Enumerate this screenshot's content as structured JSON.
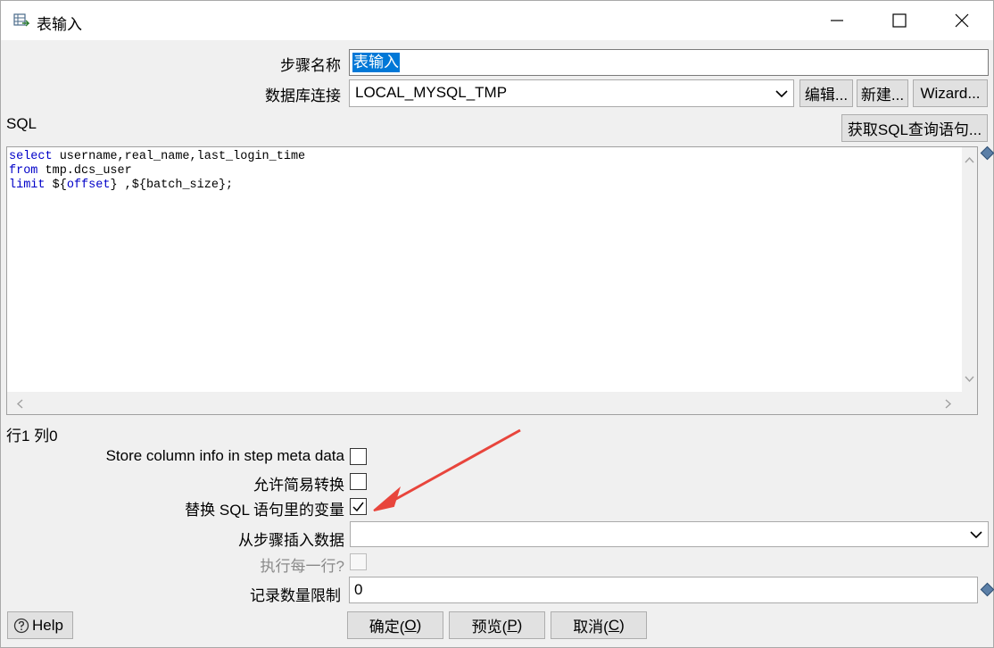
{
  "window": {
    "title": "表输入",
    "minimize_icon": "minimize-icon",
    "maximize_icon": "maximize-icon",
    "close_icon": "close-icon"
  },
  "form": {
    "step_name_label": "步骤名称",
    "step_name_value": "表输入",
    "connection_label": "数据库连接",
    "connection_value": "LOCAL_MYSQL_TMP",
    "edit_button": "编辑...",
    "new_button": "新建...",
    "wizard_button": "Wizard...",
    "sql_label": "SQL",
    "get_sql_button": "获取SQL查询语句...",
    "sql_line1_kw": "select",
    "sql_line1_rest": " username,real_name,last_login_time",
    "sql_line2_kw": "from",
    "sql_line2_rest": " tmp.dcs_user",
    "sql_line3_kw": "limit",
    "sql_line3_a": " ${",
    "sql_line3_var": "offset",
    "sql_line3_b": "} ,${batch_size};",
    "cursor_pos": "行1 列0",
    "store_column_label": "Store column info in step meta data",
    "store_column_checked": false,
    "lazy_conversion_label": "允许简易转换",
    "lazy_conversion_checked": false,
    "replace_vars_label": "替换 SQL 语句里的变量",
    "replace_vars_checked": true,
    "insert_from_step_label": "从步骤插入数据",
    "insert_from_step_value": "",
    "execute_each_row_label": "执行每一行?",
    "limit_label": "记录数量限制",
    "limit_value": "0"
  },
  "footer": {
    "help_button": "Help",
    "ok_text": "确定(",
    "ok_key": "O",
    "cancel_text": "取消(",
    "cancel_key": "C",
    "preview_text": "预览(",
    "preview_key": "P",
    "close_paren": ")"
  },
  "colors": {
    "sql_keyword": "#0000c8",
    "annotation_arrow": "#e8453c",
    "selection": "#0078d7"
  }
}
